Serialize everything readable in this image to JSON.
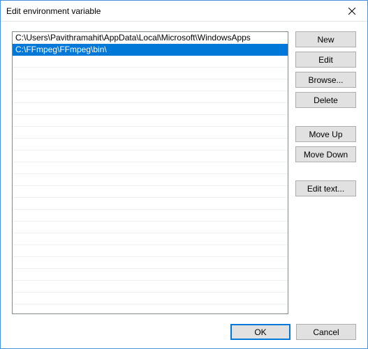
{
  "window": {
    "title": "Edit environment variable"
  },
  "list": {
    "items": [
      {
        "path": "C:\\Users\\Pavithramahit\\AppData\\Local\\Microsoft\\WindowsApps",
        "selected": false
      },
      {
        "path": "C:\\FFmpeg\\FFmpeg\\bin\\",
        "selected": true
      }
    ]
  },
  "buttons": {
    "new": "New",
    "edit": "Edit",
    "browse": "Browse...",
    "delete": "Delete",
    "move_up": "Move Up",
    "move_down": "Move Down",
    "edit_text": "Edit text...",
    "ok": "OK",
    "cancel": "Cancel"
  },
  "icons": {
    "close": "close-icon"
  }
}
